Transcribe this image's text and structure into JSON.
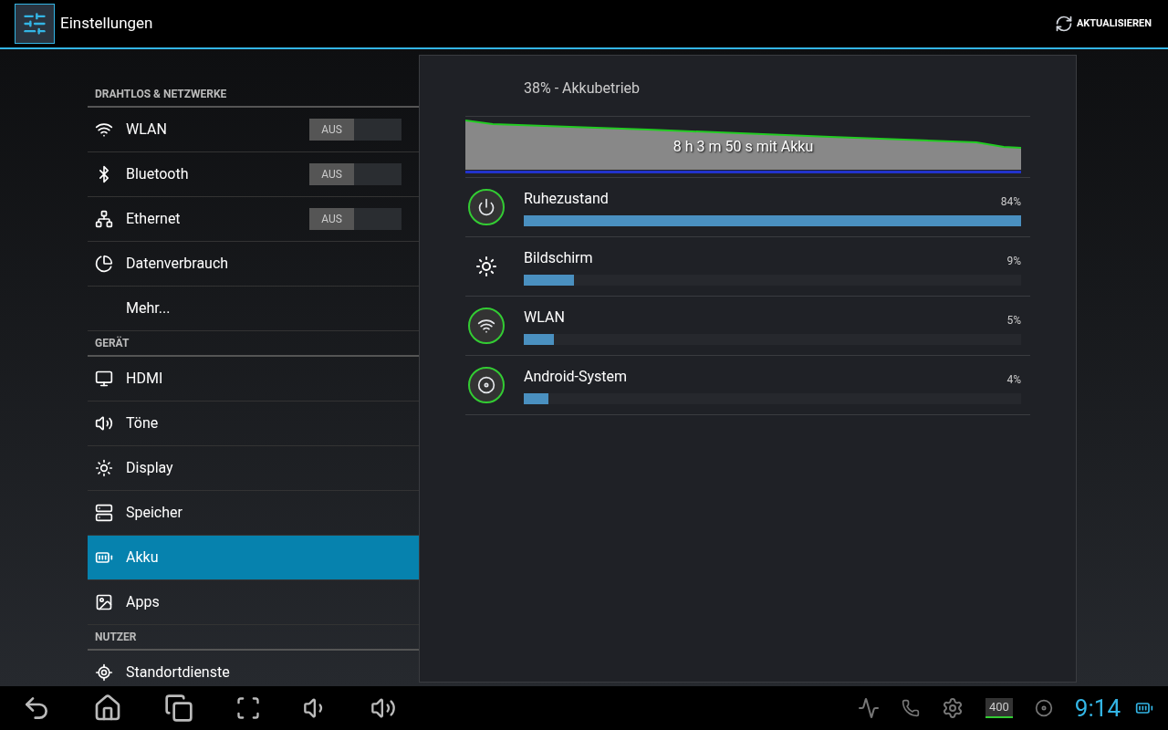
{
  "action_bar": {
    "title": "Einstellungen",
    "action": "AKTUALISIEREN"
  },
  "sidebar": {
    "sections": [
      {
        "header": "DRAHTLOS & NETZWERKE",
        "items": [
          {
            "kind": "toggle",
            "label": "WLAN",
            "toggle": "AUS",
            "on": false,
            "selected": false
          },
          {
            "kind": "toggle",
            "label": "Bluetooth",
            "toggle": "AUS",
            "on": false,
            "selected": false
          },
          {
            "kind": "toggle",
            "label": "Ethernet",
            "toggle": "AUS",
            "on": false,
            "selected": false
          },
          {
            "kind": "plain",
            "label": "Datenverbrauch",
            "selected": false
          },
          {
            "kind": "plain",
            "label": "Mehr...",
            "selected": false
          }
        ]
      },
      {
        "header": "GERÄT",
        "items": [
          {
            "kind": "plain",
            "label": "HDMI",
            "selected": false
          },
          {
            "kind": "plain",
            "label": "Töne",
            "selected": false
          },
          {
            "kind": "plain",
            "label": "Display",
            "selected": false
          },
          {
            "kind": "plain",
            "label": "Speicher",
            "selected": false
          },
          {
            "kind": "plain",
            "label": "Akku",
            "selected": true
          },
          {
            "kind": "plain",
            "label": "Apps",
            "selected": false
          }
        ]
      },
      {
        "header": "NUTZER",
        "items": [
          {
            "kind": "plain",
            "label": "Standortdienste",
            "selected": false
          }
        ]
      }
    ]
  },
  "battery": {
    "status": "38% - Akkubetrieb",
    "graph_label": "8 h 3 m 50 s mit Akku",
    "usage": [
      {
        "kind": "power",
        "name": "Ruhezustand",
        "percent": "84%",
        "level": 1.0
      },
      {
        "kind": "screen",
        "name": "Bildschirm",
        "percent": "9%",
        "level": 0.1
      },
      {
        "kind": "wifi",
        "name": "WLAN",
        "percent": "5%",
        "level": 0.06
      },
      {
        "kind": "system",
        "name": "Android-System",
        "percent": "4%",
        "level": 0.05
      }
    ]
  },
  "system_bar": {
    "badge": "400",
    "time": "9:14"
  }
}
